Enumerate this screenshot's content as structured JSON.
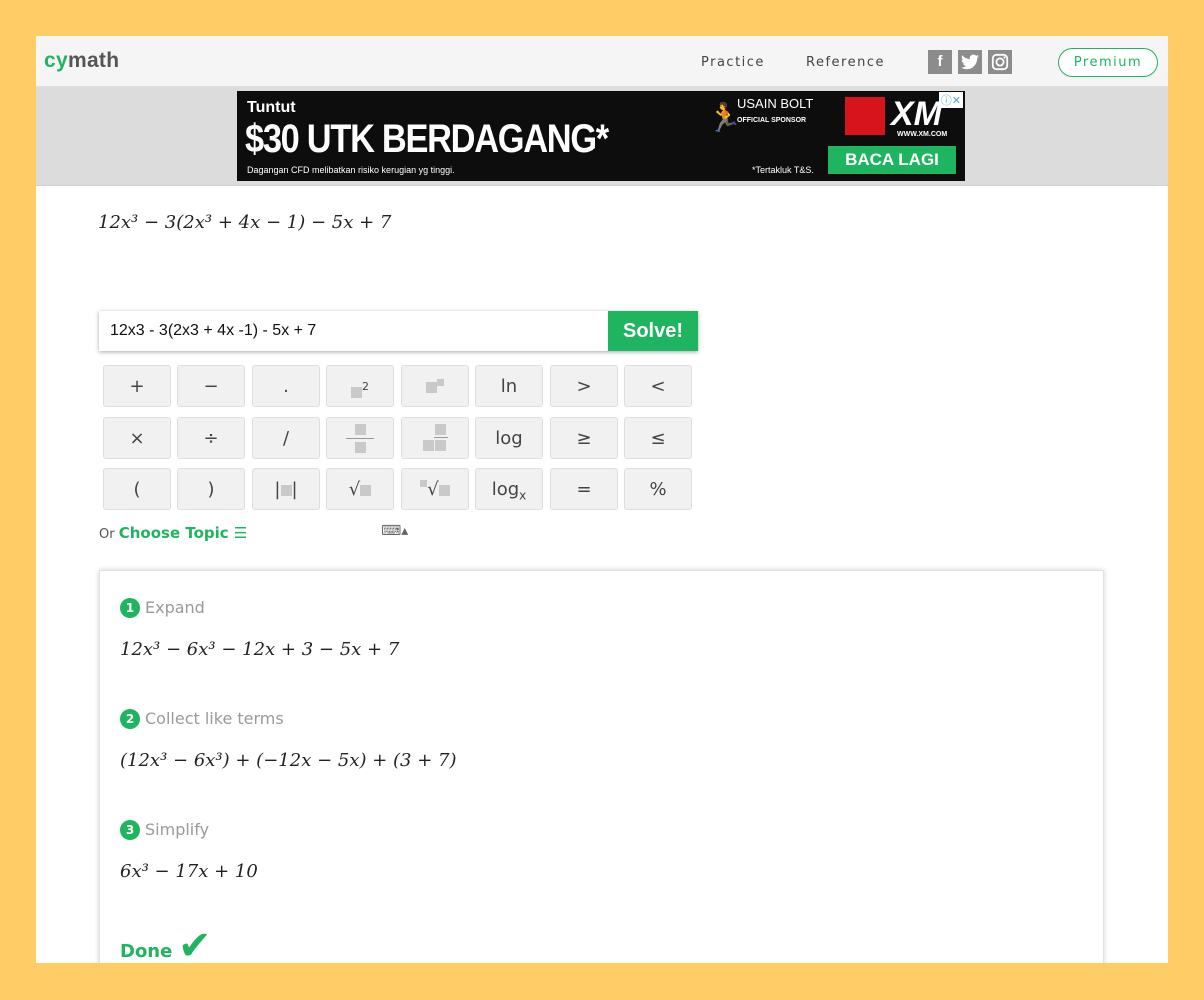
{
  "header": {
    "logo_cy": "cy",
    "logo_math": "math",
    "nav": [
      "Practice",
      "Reference"
    ],
    "social": [
      "f",
      "t",
      "ig"
    ],
    "premium_label": "Premium"
  },
  "ad": {
    "line1": "Tuntut",
    "headline": "$30 UTK BERDAGANG*",
    "disclaimer": "Dagangan CFD melibatkan risiko kerugian yg tinggi.",
    "sponsor_name": "USAIN BOLT",
    "sponsor_tag": "OFFICIAL SPONSOR",
    "tnc": "*Tertakluk T&S.",
    "brand": "XM",
    "brand_site": "WWW.XM.COM",
    "cta": "BACA LAGI"
  },
  "expression": "12x³ − 3(2x³ + 4x − 1) − 5x + 7",
  "input": {
    "value": "12x3 - 3(2x3 + 4x -1) - 5x + 7",
    "solve_label": "Solve!"
  },
  "keypad": {
    "row1": [
      "+",
      "−",
      ".",
      "x²",
      "xⁿ",
      "ln",
      ">",
      "<"
    ],
    "row2": [
      "×",
      "÷",
      "/",
      "frac",
      "mixed",
      "log",
      "≥",
      "≤"
    ],
    "row3": [
      "(",
      ")",
      "|x|",
      "√",
      "ⁿ√",
      "logₓ",
      "=",
      "%"
    ]
  },
  "topic": {
    "or_label": "Or",
    "choose_label": "Choose Topic ☰"
  },
  "steps": [
    {
      "num": "1",
      "title": "Expand",
      "math": "12x³ − 6x³ − 12x + 3 − 5x + 7"
    },
    {
      "num": "2",
      "title": "Collect like terms",
      "math": "(12x³ − 6x³) + (−12x − 5x) + (3 + 7)"
    },
    {
      "num": "3",
      "title": "Simplify",
      "math": "6x³ − 17x + 10"
    }
  ],
  "done_label": "Done",
  "colors": {
    "accent": "#1fb45f",
    "page_bg": "#ffcc66"
  }
}
